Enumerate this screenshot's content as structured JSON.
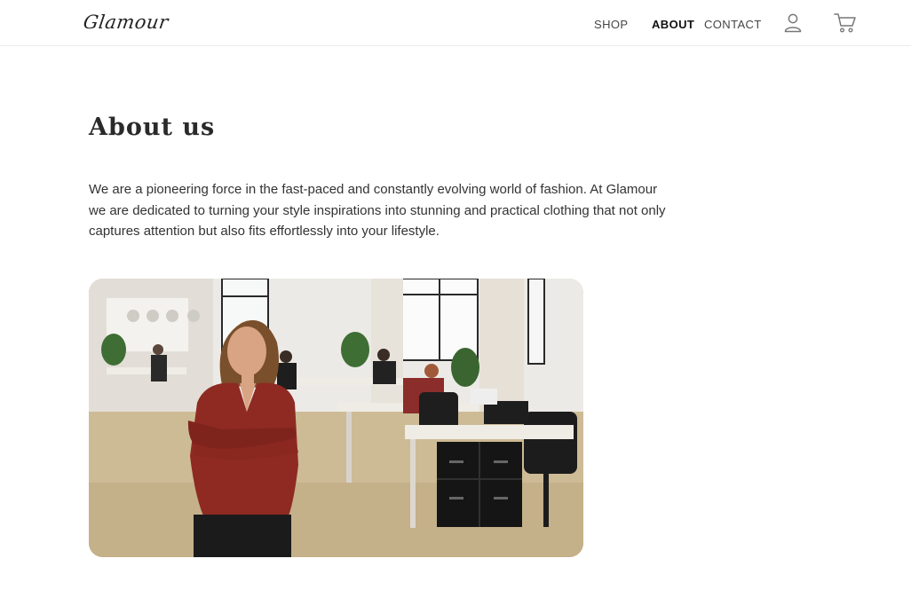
{
  "header": {
    "logo": "Glamour",
    "nav": {
      "shop": "SHOP",
      "about": "ABOUT",
      "contact": "CONTACT"
    },
    "icons": {
      "user": "user-icon",
      "cart": "cart-icon"
    }
  },
  "main": {
    "title": "About us",
    "intro": "We are a pioneering force in the fast-paced and constantly evolving world of fashion. At Glamour we are dedicated to turning your style inspirations into stunning and practical clothing that not only captures attention but also fits effortlessly into your lifestyle.",
    "hero_image": "office-team-photo"
  },
  "colors": {
    "text": "#222222",
    "nav_active": "#111111",
    "shirt": "#8e2a22",
    "floor": "#cdbb96"
  }
}
